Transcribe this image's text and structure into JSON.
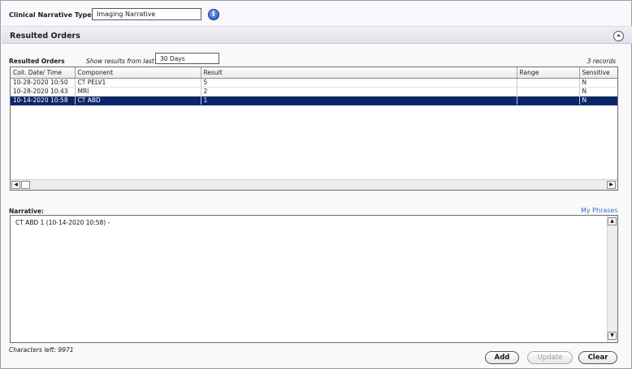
{
  "header": {
    "type_label": "Clinical Narrative Type",
    "type_value": "Imaging Narrative",
    "info_icon": "i"
  },
  "section": {
    "title": "Resulted Orders",
    "collapse_icon": "⏶"
  },
  "orders": {
    "label": "Resulted Orders",
    "show_label": "Show results from last",
    "show_value": "30 Days",
    "records": "3 records",
    "columns": [
      "Coll. Date/ Time",
      "Component",
      "Result",
      "Range",
      "Sensitive"
    ],
    "rows": [
      {
        "date": "10-28-2020 10:50",
        "component": "CT PELV1",
        "result": "5",
        "range": "",
        "sensitive": "N",
        "selected": false
      },
      {
        "date": "10-28-2020 10:43",
        "component": "MRI",
        "result": "2",
        "range": "",
        "sensitive": "N",
        "selected": false
      },
      {
        "date": "10-14-2020 10:58",
        "component": "CT ABD",
        "result": "1",
        "range": "",
        "sensitive": "N",
        "selected": true
      }
    ]
  },
  "narrative": {
    "label": "Narrative:",
    "phrases_link": "My Phrases",
    "text": "CT ABD 1 (10-14-2020 10:58) -",
    "chars_left": "Characters left: 9971"
  },
  "buttons": {
    "add": "Add",
    "update": "Update",
    "clear": "Clear"
  }
}
